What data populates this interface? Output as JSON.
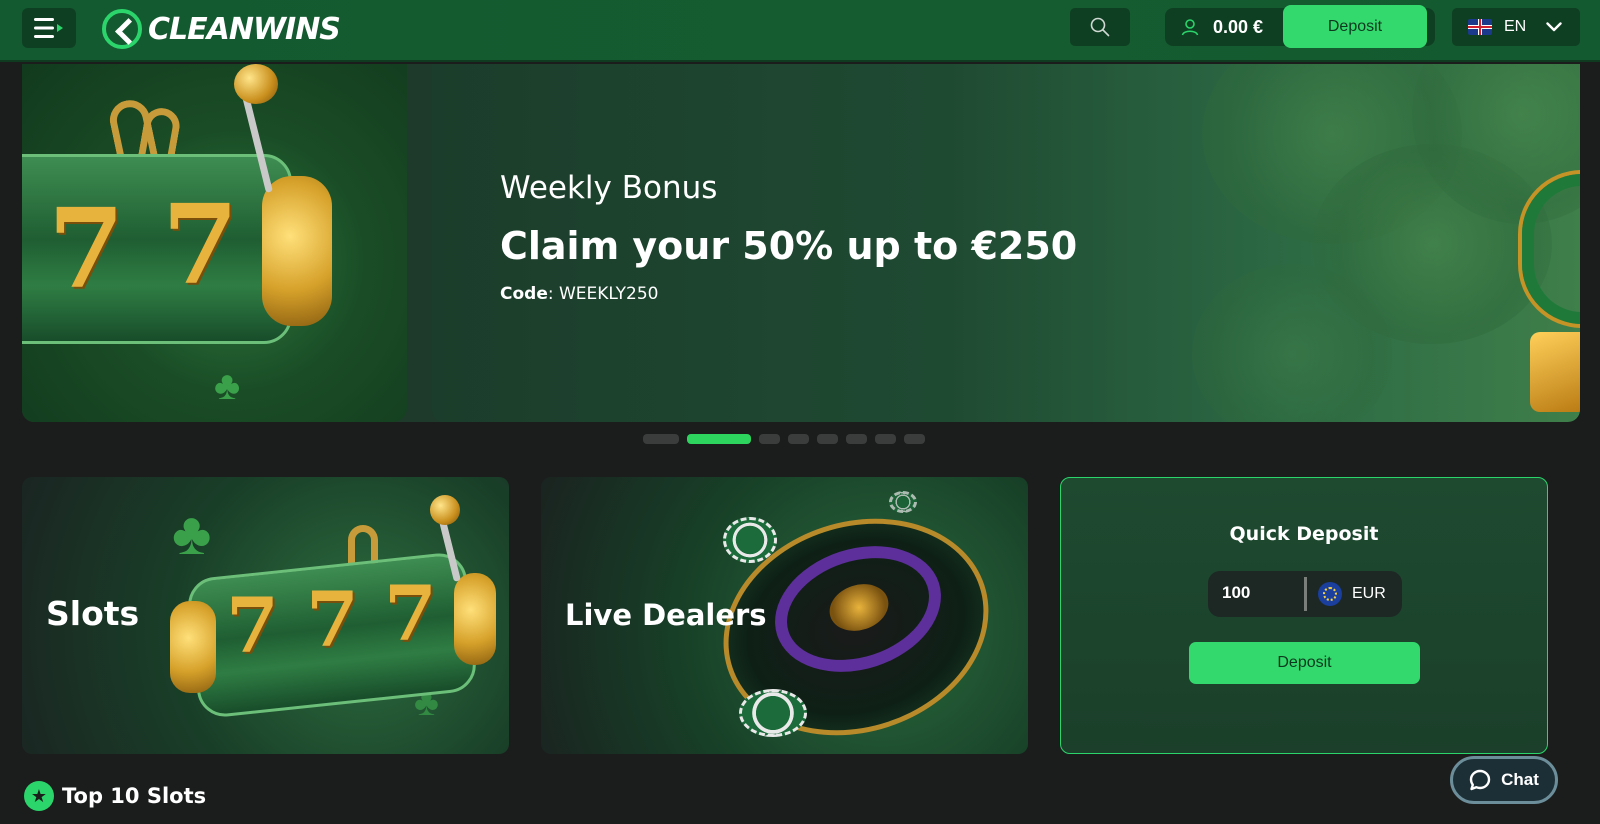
{
  "header": {
    "logo_text": "CLEANWINS",
    "balance": "0.00 €",
    "deposit_label": "Deposit",
    "language": "EN"
  },
  "hero": {
    "subtitle": "Weekly Bonus",
    "title": "Claim your 50% up to €250",
    "code_label": "Code",
    "code_value": ": WEEKLY250",
    "slides_total": 8,
    "active_slide": 2
  },
  "categories": [
    {
      "label": "Slots"
    },
    {
      "label": "Live Dealers"
    }
  ],
  "quick_deposit": {
    "title": "Quick Deposit",
    "amount": "100",
    "currency": "EUR",
    "button_label": "Deposit"
  },
  "section": {
    "title": "Top 10 Slots"
  },
  "chat": {
    "label": "Chat"
  },
  "colors": {
    "brand_green": "#34d96e",
    "header_bg": "#165c31",
    "page_bg": "#1b1d1c"
  },
  "icons": [
    "menu-icon",
    "search-icon",
    "user-icon",
    "chevron-down-icon",
    "star-icon",
    "chat-icon",
    "uk-flag-icon",
    "eu-flag-icon"
  ]
}
